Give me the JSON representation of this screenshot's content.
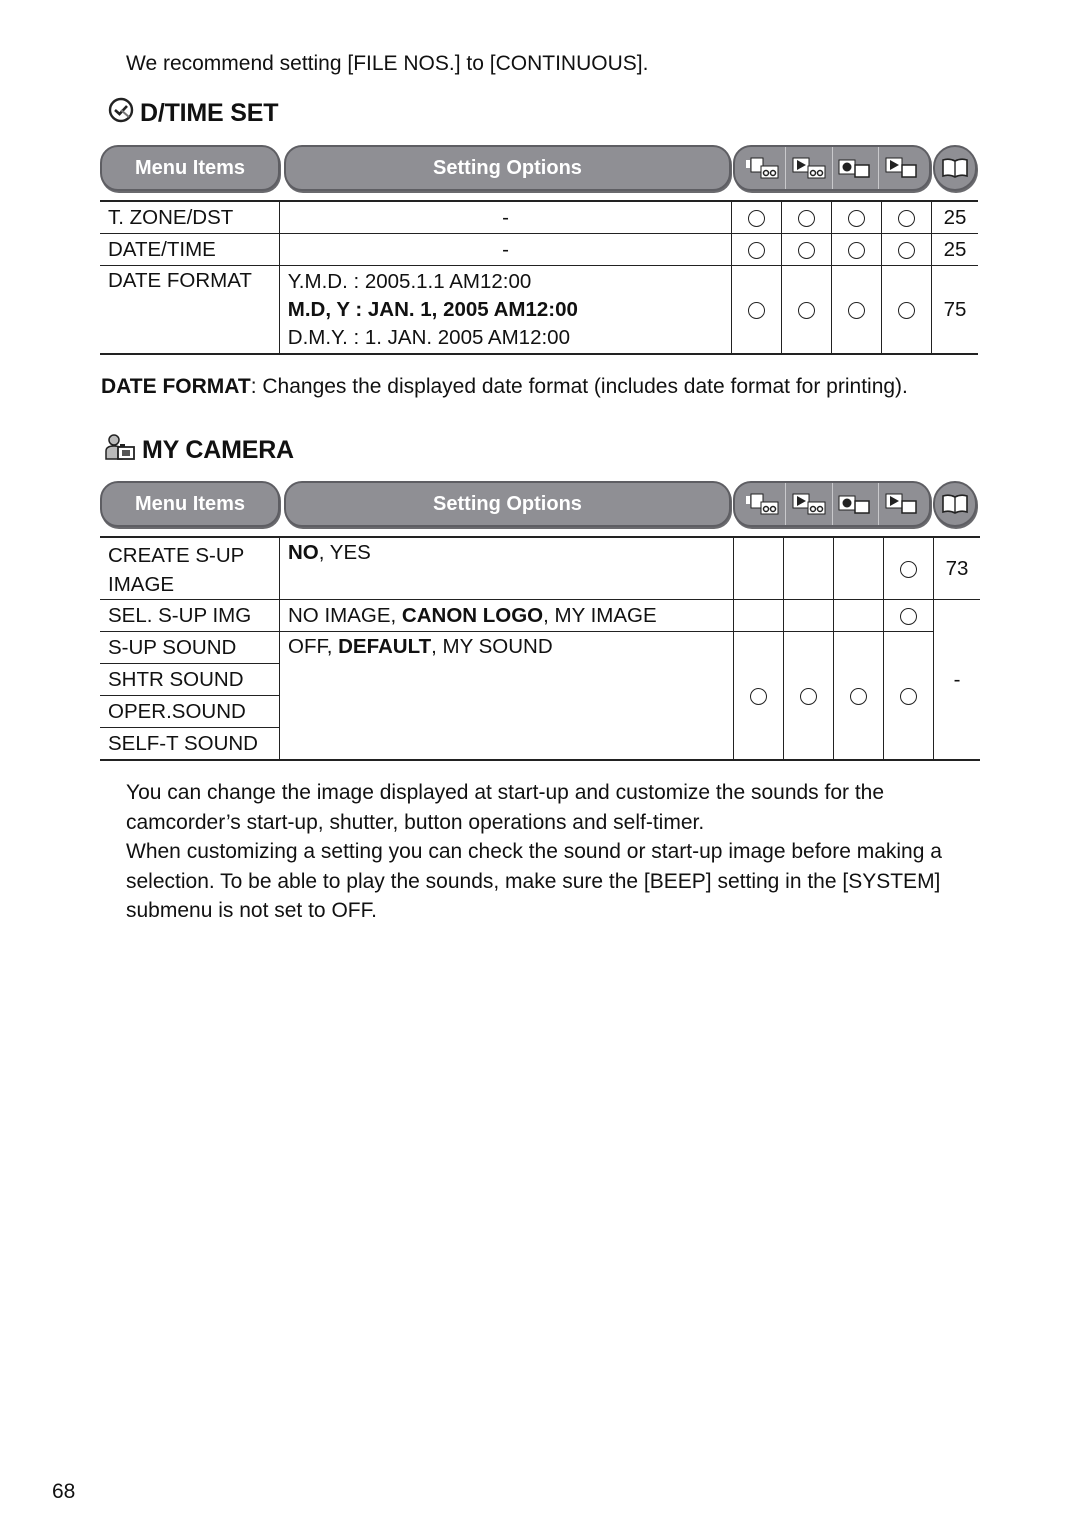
{
  "intro_text": "We recommend setting [FILE NOS.] to [CONTINUOUS].",
  "sections": [
    {
      "title": "D/TIME SET",
      "icon": "clock-check-icon",
      "header": {
        "menu_items_label": "Menu Items",
        "setting_options_label": "Setting Options",
        "mode_icons": [
          "camera-tape-icon",
          "play-tape-icon",
          "camera-card-icon",
          "play-card-icon"
        ],
        "page_icon": "book-icon"
      },
      "rows": [
        {
          "item": "T. ZONE/DST",
          "options": "-",
          "modes": [
            true,
            true,
            true,
            true
          ],
          "page": "25"
        },
        {
          "item": "DATE/TIME",
          "options": "-",
          "modes": [
            true,
            true,
            true,
            true
          ],
          "page": "25"
        },
        {
          "item": "DATE FORMAT",
          "options_lines": [
            {
              "text": "Y.M.D. : 2005.1.1 AM12:00",
              "bold": false
            },
            {
              "text": "M.D, Y : JAN. 1, 2005 AM12:00",
              "bold": true
            },
            {
              "text": "D.M.Y. : 1. JAN. 2005 AM12:00",
              "bold": false
            }
          ],
          "modes": [
            true,
            true,
            true,
            true
          ],
          "page": "75"
        }
      ],
      "note": {
        "term": "DATE FORMAT",
        "text": ": Changes the displayed date format (includes date format for printing)."
      }
    },
    {
      "title": "MY CAMERA",
      "icon": "my-camera-icon",
      "header": {
        "menu_items_label": "Menu Items",
        "setting_options_label": "Setting Options",
        "mode_icons": [
          "camera-tape-icon",
          "play-tape-icon",
          "camera-card-icon",
          "play-card-icon"
        ],
        "page_icon": "book-icon"
      },
      "rows": [
        {
          "item": "CREATE S-UP IMAGE",
          "options": [
            {
              "t": "NO",
              "b": true
            },
            {
              "t": ", YES",
              "b": false
            }
          ],
          "modes": [
            false,
            false,
            false,
            true
          ],
          "page": "73"
        },
        {
          "item": "SEL. S-UP IMG",
          "options": [
            {
              "t": "NO IMAGE, ",
              "b": false
            },
            {
              "t": "CANON LOGO",
              "b": true
            },
            {
              "t": ", MY IMAGE",
              "b": false
            }
          ],
          "modes": [
            false,
            false,
            false,
            true
          ],
          "page": "-"
        },
        {
          "item": "S-UP SOUND",
          "options": [
            {
              "t": "OFF, ",
              "b": false
            },
            {
              "t": "DEFAULT",
              "b": true
            },
            {
              "t": ", MY SOUND",
              "b": false
            }
          ],
          "modes": [
            true,
            true,
            true,
            true
          ]
        },
        {
          "item": "SHTR SOUND"
        },
        {
          "item": "OPER.SOUND"
        },
        {
          "item": "SELF-T SOUND"
        }
      ]
    }
  ],
  "body_text": [
    "You can change the image displayed at start-up and customize the sounds for the camcorder’s start-up, shutter, button operations and self-timer.",
    "When customizing a setting you can check the sound or start-up image before making a selection. To be able to play the sounds, make sure the [BEEP] setting in the [SYSTEM] submenu is not set to OFF."
  ],
  "page_number": "68"
}
